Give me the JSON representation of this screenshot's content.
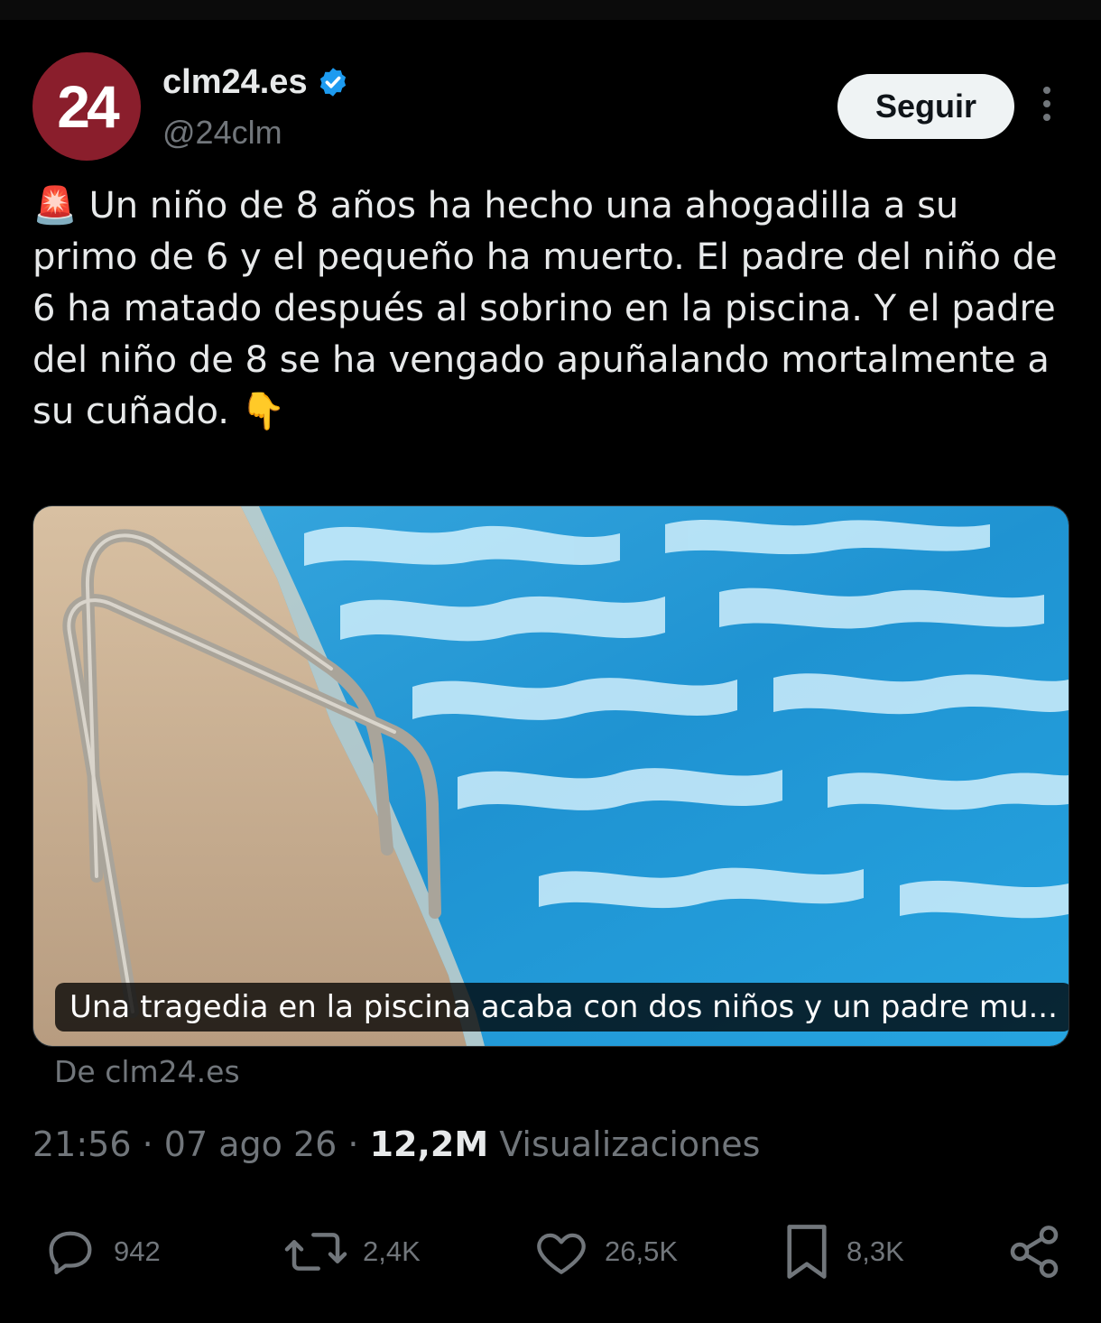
{
  "account": {
    "avatar_text": "24",
    "display_name": "clm24.es",
    "handle": "@24clm",
    "verified": true,
    "verified_color": "#1d9bf0",
    "avatar_color": "#8a1e2c"
  },
  "header": {
    "follow_label": "Seguir"
  },
  "tweet": {
    "lead_emoji": "🚨",
    "text": "Un niño de 8 años ha hecho una ahogadilla a su primo de 6 y el pequeño ha muerto. El padre del niño de 6 ha matado después al sobrino en la piscina. Y el padre del niño de 8 se ha vengado apuñalando mortalmente a su cuñado.",
    "trail_emoji": "👇"
  },
  "link_card": {
    "title": "Una tragedia en la piscina acaba con dos niños y un padre mu...",
    "source": "De clm24.es"
  },
  "meta": {
    "time": "21:56",
    "date": "07 ago 26",
    "views_count": "12,2M",
    "views_label": "Visualizaciones"
  },
  "actions": {
    "replies": "942",
    "reposts": "2,4K",
    "likes": "26,5K",
    "bookmarks": "8,3K"
  },
  "icons": [
    "more-options-icon",
    "verified-badge-icon",
    "reply-icon",
    "repost-icon",
    "like-icon",
    "bookmark-icon",
    "share-icon"
  ]
}
